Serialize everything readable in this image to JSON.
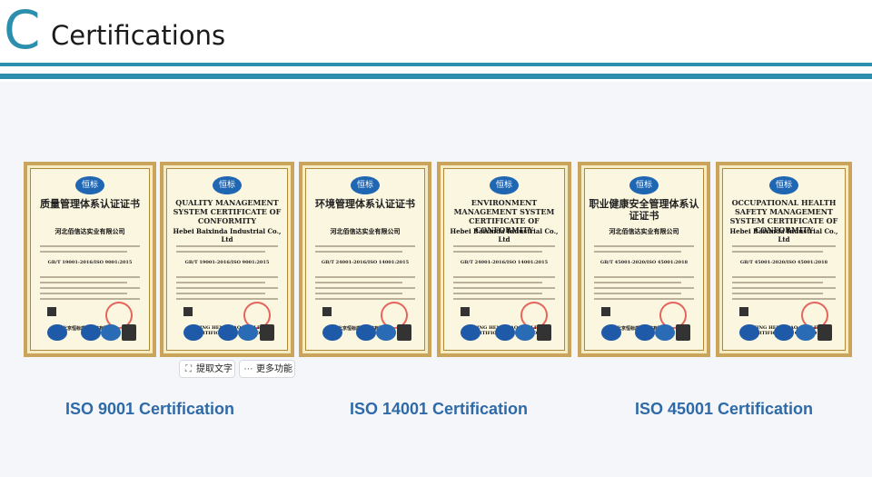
{
  "header": {
    "logo_letter": "C",
    "title": "Certifications"
  },
  "certificates": [
    {
      "lang": "zh",
      "seal": "恒标",
      "title": "质量管理体系认证证书",
      "company": "河北佰信达实业有限公司",
      "standard": "GB/T 19001-2016/ISO 9001:2015",
      "issuer": "北京恒标质量认证有限公司"
    },
    {
      "lang": "en",
      "seal": "恒标",
      "title": "QUALITY MANAGEMENT SYSTEM CERTIFICATE OF CONFORMITY",
      "company": "Hebei Baixinda Industrial Co., Ltd",
      "standard": "GB/T 19001-2016/ISO 9001:2015",
      "issuer": "BEIJING HENGBIAO QUALITY CERTIFICATION CO., LTD"
    },
    {
      "lang": "zh",
      "seal": "恒标",
      "title": "环境管理体系认证证书",
      "company": "河北佰信达实业有限公司",
      "standard": "GB/T 24001-2016/ISO 14001:2015",
      "issuer": "北京恒标质量认证有限公司"
    },
    {
      "lang": "en",
      "seal": "恒标",
      "title": "ENVIRONMENT MANAGEMENT SYSTEM CERTIFICATE OF CONFORMITY",
      "company": "Hebei Baixinda Industrial Co., Ltd",
      "standard": "GB/T 24001-2016/ISO 14001:2015",
      "issuer": "BEIJING HENGBIAO QUALITY CERTIFICATION CO., LTD"
    },
    {
      "lang": "zh",
      "seal": "恒标",
      "title": "职业健康安全管理体系认证证书",
      "company": "河北佰信达实业有限公司",
      "standard": "GB/T 45001-2020/ISO 45001:2018",
      "issuer": "北京恒标质量认证有限公司"
    },
    {
      "lang": "en",
      "seal": "恒标",
      "title": "OCCUPATIONAL HEALTH SAFETY MANAGEMENT SYSTEM CERTIFICATE OF CONFORMITY",
      "company": "Hebei Baixinda Industrial Co., Ltd",
      "standard": "GB/T 45001-2020/ISO 45001:2018",
      "issuer": "BEIJING HENGBIAO QUALITY CERTIFICATION CO., LTD"
    }
  ],
  "image_toolbar": {
    "extract_text_label": "提取文字",
    "extract_text_icon": "text-scan-icon",
    "more_label": "更多功能",
    "more_icon": "more-dots-icon"
  },
  "captions": [
    "ISO 9001 Certification",
    "ISO 14001 Certification",
    "ISO 45001 Certification"
  ],
  "colors": {
    "accent": "#2b8fad",
    "caption": "#2f6aa8",
    "certificate_frame": "#c9a45a"
  }
}
